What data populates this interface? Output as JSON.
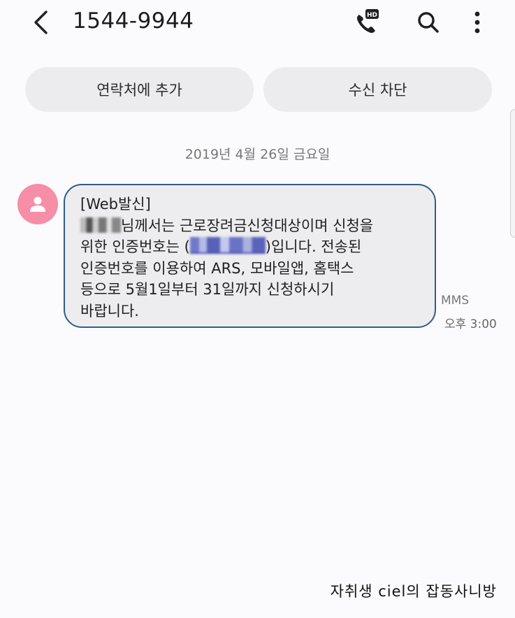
{
  "header": {
    "title": "1544-9944",
    "icons": [
      "back-arrow-icon",
      "hd-call-icon",
      "search-icon",
      "more-vert-icon"
    ],
    "hd_badge": "HD"
  },
  "actions": {
    "add_contact": "연락처에 추가",
    "block": "수신 차단"
  },
  "conversation": {
    "date": "2019년 4월 26일 금요일",
    "message": {
      "sender_tag": "[Web발신]",
      "line1_suffix": "님께서는 근로장려금신청대상이며 신청을",
      "line2_prefix": "위한 인증번호는 (",
      "line2_suffix": ")입니다. 전송된",
      "line3": "인증번호를 이용하여 ARS, 모바일앱, 홈택스",
      "line4": "등으로 5월1일부터 31일까지 신청하시기",
      "line5": "바랍니다.",
      "type": "MMS",
      "time": "오후 3:00"
    }
  },
  "watermark": "자취생 ciel의 잡동사니방",
  "colors": {
    "background": "#fbfbfd",
    "bubble_border": "#2f5d88",
    "bubble_fill": "#ededef",
    "avatar": "#f58ea6",
    "button_fill": "#ececee"
  }
}
